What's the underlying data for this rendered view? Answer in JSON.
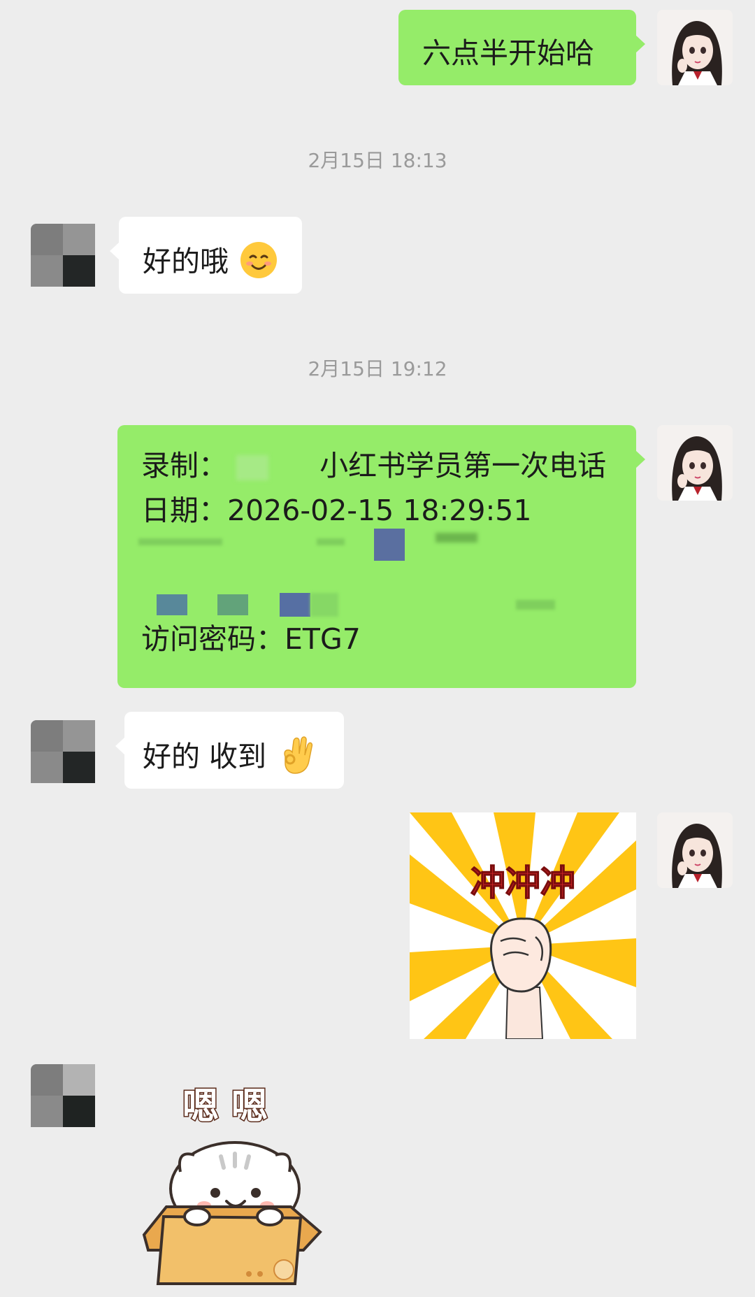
{
  "messages": [
    {
      "text": "六点半开始哈"
    },
    {
      "time": "2月15日 18:13"
    },
    {
      "text": "好的哦",
      "emoji": "smile-emoji"
    },
    {
      "time": "2月15日 19:12"
    },
    {
      "record_label": "录制：",
      "record_title": "小红书学员第一次电话",
      "date_label": "日期：",
      "date_value": "2026-02-15 18:29:51",
      "password_label": "访问密码：",
      "password_value": "ETG7"
    },
    {
      "text": "好的 收到",
      "emoji": "ok-hand-emoji"
    },
    {
      "sticker_text": "冲冲冲"
    },
    {
      "sticker_text": "嗯 嗯"
    }
  ],
  "colors": {
    "background": "#ededed",
    "outgoing_bubble": "#95ec69",
    "incoming_bubble": "#ffffff",
    "timestamp": "#9a9a9a"
  }
}
